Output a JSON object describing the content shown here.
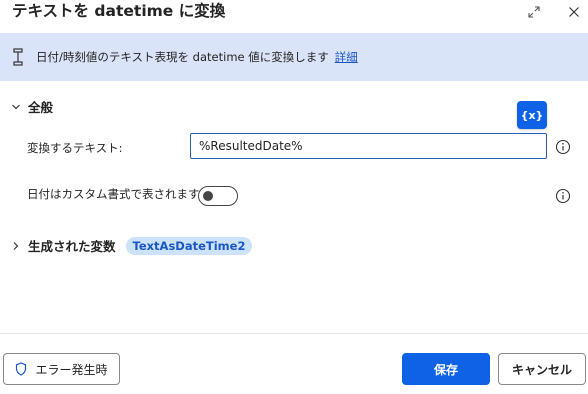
{
  "dialog": {
    "title": "テキストを datetime に変換",
    "icons": {
      "expand": "expand-icon",
      "close": "close-icon"
    }
  },
  "info_bar": {
    "icon": "action-info-icon",
    "text": "日付/時刻値のテキスト表現を datetime 値に変換します",
    "link": "詳細"
  },
  "general": {
    "label": "全般",
    "expanded": true,
    "var_button": "{x}",
    "fields": {
      "text_to_convert": {
        "label": "変換するテキスト:",
        "value": "%ResultedDate%"
      },
      "custom_format": {
        "label": "日付はカスタム書式で表されます:",
        "on": false
      }
    }
  },
  "generated_vars": {
    "label": "生成された変数",
    "expanded": false,
    "chip": "TextAsDateTime2"
  },
  "footer": {
    "on_error": "エラー発生時",
    "save": "保存",
    "cancel": "キャンセル"
  },
  "colors": {
    "accent": "#0f62e6",
    "info_bg": "#dae4f8",
    "chip_bg": "#cde3f9",
    "link": "#1a56c4"
  }
}
